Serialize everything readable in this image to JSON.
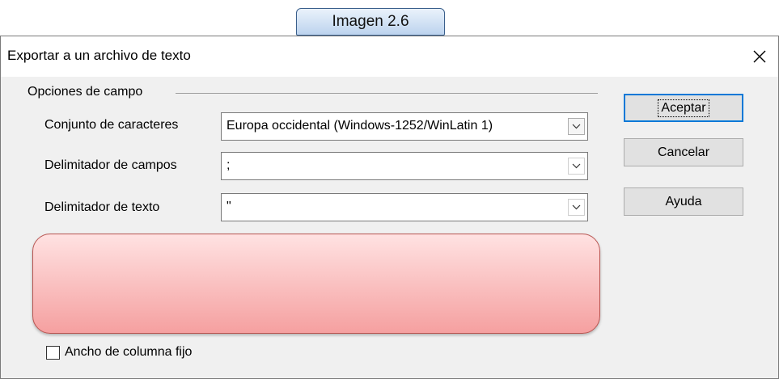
{
  "caption": "Imagen 2.6",
  "dialog": {
    "title": "Exportar a un archivo de texto",
    "close_glyph": "✕"
  },
  "field_options": {
    "group_label": "Opciones de campo",
    "charset": {
      "label": "Conjunto de caracteres",
      "value": "Europa occidental (Windows-1252/WinLatin 1)"
    },
    "field_delimiter": {
      "label": "Delimitador de campos",
      "value": ";"
    },
    "text_delimiter": {
      "label": "Delimitador de texto",
      "value": "\""
    },
    "fixed_width": {
      "label": "Ancho de columna fijo",
      "checked": false
    }
  },
  "buttons": {
    "accept": "Aceptar",
    "cancel": "Cancelar",
    "help": "Ayuda"
  },
  "colors": {
    "accent": "#0078d7",
    "overlay_fill": "#f5a0a0",
    "overlay_border": "#b85450"
  }
}
